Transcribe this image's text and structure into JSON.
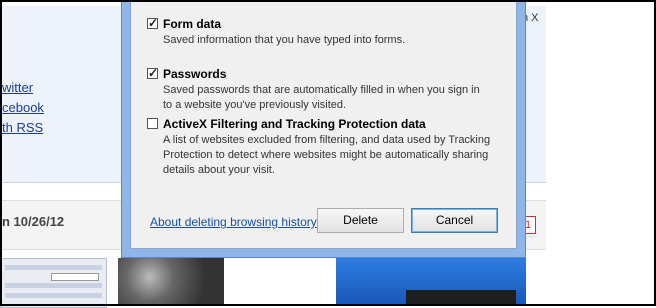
{
  "background": {
    "right_snippet": "n X",
    "links": [
      "witter",
      "cebook",
      "th RSS"
    ],
    "date_text": "n 10/26/12",
    "badge": "1"
  },
  "dialog": {
    "options": [
      {
        "title": "Form data",
        "checked": true,
        "desc": [
          "Saved information that you have typed into forms."
        ]
      },
      {
        "title": "Passwords",
        "checked": true,
        "desc": [
          "Saved passwords that are automatically filled in when you sign in",
          "to a website you've previously visited."
        ]
      },
      {
        "title": "ActiveX Filtering and Tracking Protection data",
        "checked": false,
        "desc": [
          "A list of websites excluded from filtering, and data used by Tracking",
          "Protection to detect where websites might be automatically sharing",
          "details about your visit."
        ]
      }
    ],
    "about_link": "About deleting browsing history",
    "delete_label": "Delete",
    "cancel_label": "Cancel"
  }
}
